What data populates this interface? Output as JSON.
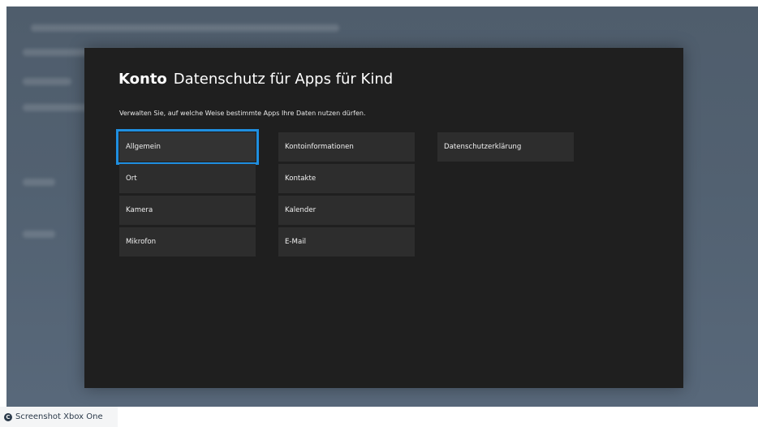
{
  "header": {
    "title_bold": "Konto",
    "title_rest": "Datenschutz für Apps für Kind",
    "subtitle": "Verwalten Sie, auf welche Weise bestimmte Apps Ihre Daten nutzen dürfen."
  },
  "columns": [
    {
      "items": [
        {
          "label": "Allgemein"
        },
        {
          "label": "Ort"
        },
        {
          "label": "Kamera"
        },
        {
          "label": "Mikrofon"
        }
      ]
    },
    {
      "items": [
        {
          "label": "Kontoinformationen"
        },
        {
          "label": "Kontakte"
        },
        {
          "label": "Kalender"
        },
        {
          "label": "E-Mail"
        }
      ]
    },
    {
      "items": [
        {
          "label": "Datenschutzerklärung"
        }
      ]
    }
  ],
  "focused_item": "Allgemein",
  "caption": {
    "text": "Screenshot Xbox One",
    "icon": "copyright-icon"
  },
  "colors": {
    "panel_bg": "#1f1f1f",
    "tile_bg": "#2d2d2d",
    "focus_ring": "#1f8fe0",
    "backdrop": "#526171"
  }
}
